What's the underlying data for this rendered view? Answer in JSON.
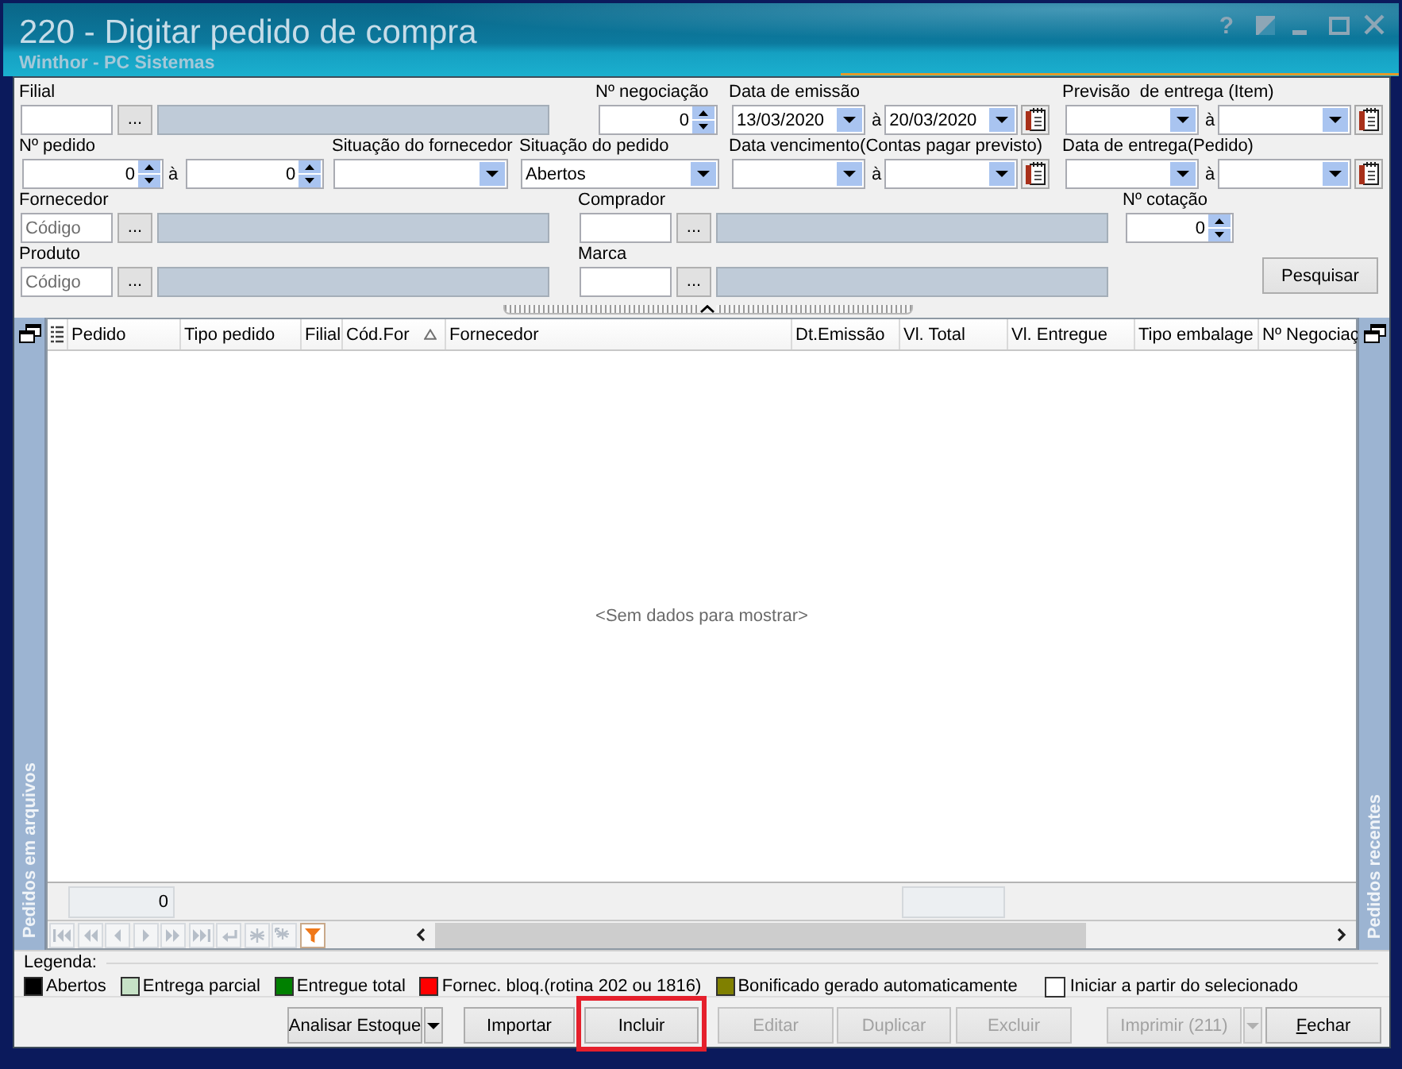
{
  "window": {
    "title": "220 - Digitar pedido de compra",
    "subtitle": "Winthor - PC Sistemas",
    "buttons": [
      {
        "kind": "help",
        "label": "?"
      },
      {
        "kind": "layout"
      },
      {
        "kind": "minimize"
      },
      {
        "kind": "maximize"
      },
      {
        "kind": "close"
      }
    ]
  },
  "filters": {
    "filial": {
      "label": "Filial",
      "lookup": "..."
    },
    "negociacao": {
      "label": "Nº negociação",
      "value": "0"
    },
    "data_emissao": {
      "label": "Data de emissão",
      "from": "13/03/2020",
      "separator": "à",
      "to": "20/03/2020"
    },
    "previsao_entrega": {
      "label": "Previsão  de entrega (Item)",
      "separator": "à"
    },
    "pedido": {
      "label": "Nº pedido",
      "from": "0",
      "separator": "à",
      "to": "0"
    },
    "situacao_fornecedor": {
      "label": "Situação do fornecedor"
    },
    "situacao_pedido": {
      "label": "Situação do pedido",
      "value": "Abertos"
    },
    "data_vencimento": {
      "label": "Data vencimento(Contas pagar previsto)",
      "separator": "à"
    },
    "data_entrega": {
      "label": "Data de entrega(Pedido)",
      "separator": "à"
    },
    "fornecedor": {
      "label": "Fornecedor",
      "placeholder": "Código",
      "lookup": "..."
    },
    "comprador": {
      "label": "Comprador",
      "lookup": "..."
    },
    "cotacao": {
      "label": "Nº cotação",
      "value": "0"
    },
    "produto": {
      "label": "Produto",
      "placeholder": "Código",
      "lookup": "..."
    },
    "marca": {
      "label": "Marca",
      "lookup": "..."
    },
    "search_button": "Pesquisar"
  },
  "grid": {
    "left_panel": "Pedidos em arquivos",
    "right_panel": "Pedidos recentes",
    "columns": [
      {
        "label": "Pedido",
        "sorted": false
      },
      {
        "label": "Tipo pedido",
        "sorted": false
      },
      {
        "label": "Filial",
        "sorted": false
      },
      {
        "label": "Cód.For",
        "sorted": true
      },
      {
        "label": "Fornecedor",
        "sorted": false
      },
      {
        "label": "Dt.Emissão",
        "sorted": false
      },
      {
        "label": "Vl. Total",
        "sorted": false
      },
      {
        "label": "Vl. Entregue",
        "sorted": false
      },
      {
        "label": "Tipo embalage",
        "sorted": false
      },
      {
        "label": "Nº Negociaç",
        "sorted": false
      }
    ],
    "empty_message": "<Sem dados para mostrar>",
    "summary": {
      "pedido": "0"
    },
    "navigator": [
      {
        "kind": "first",
        "disabled": true
      },
      {
        "kind": "prior-page",
        "disabled": true
      },
      {
        "kind": "prior",
        "disabled": true
      },
      {
        "kind": "next",
        "disabled": true
      },
      {
        "kind": "next-page",
        "disabled": true
      },
      {
        "kind": "last",
        "disabled": true
      },
      {
        "kind": "return",
        "disabled": true
      },
      {
        "kind": "asterisk",
        "disabled": true
      },
      {
        "kind": "asterisk-arrow",
        "disabled": true
      },
      {
        "kind": "filter",
        "disabled": false
      }
    ]
  },
  "legend": {
    "title": "Legenda:",
    "items": [
      {
        "label": "Abertos",
        "color": "#000000"
      },
      {
        "label": "Entrega parcial",
        "color": "#c6e2c6"
      },
      {
        "label": "Entregue total",
        "color": "#008000"
      },
      {
        "label": "Fornec. bloq.(rotina 202 ou 1816)",
        "color": "#ff0000"
      },
      {
        "label": "Bonificado gerado automaticamente",
        "color": "#808000"
      }
    ],
    "checkbox": {
      "label": "Iniciar a partir do selecionado",
      "checked": false
    }
  },
  "buttons": [
    {
      "label": "Analisar Estoque",
      "kind": "split",
      "disabled": false,
      "highlighted": false,
      "mnemonic": false
    },
    {
      "label": "Importar",
      "kind": "plain",
      "disabled": false,
      "highlighted": false,
      "mnemonic": false
    },
    {
      "label": "Incluir",
      "kind": "plain",
      "disabled": false,
      "highlighted": true,
      "mnemonic": false
    },
    {
      "label": "Editar",
      "kind": "plain",
      "disabled": true,
      "highlighted": false,
      "mnemonic": false
    },
    {
      "label": "Duplicar",
      "kind": "plain",
      "disabled": true,
      "highlighted": false,
      "mnemonic": false
    },
    {
      "label": "Excluir",
      "kind": "plain",
      "disabled": true,
      "highlighted": false,
      "mnemonic": false
    },
    {
      "label": "Imprimir (211)",
      "kind": "split",
      "disabled": true,
      "highlighted": false,
      "mnemonic": false
    },
    {
      "label": "Fechar",
      "kind": "plain",
      "disabled": false,
      "highlighted": false,
      "mnemonic": true
    }
  ]
}
